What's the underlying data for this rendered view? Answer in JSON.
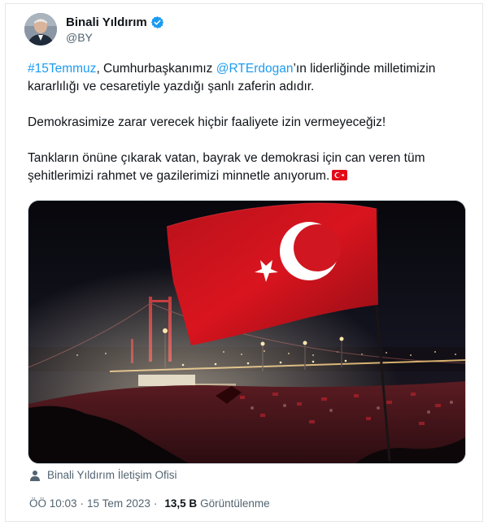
{
  "author": {
    "display_name": "Binali Yıldırım",
    "handle": "@BY",
    "verified": true
  },
  "tweet": {
    "hashtag": "#15Temmuz",
    "line1_after_hashtag": ", Cumhurbaşkanımız ",
    "mention": "@RTErdogan",
    "line1_rest": "’ın liderliğinde milletimizin kararlılığı ve cesaretiyle yazdığı şanlı zaferin adıdır.",
    "paragraph2": "Demokrasimize zarar verecek hiçbir faaliyete izin vermeyeceğiz!",
    "paragraph3": "Tankların önüne çıkarak vatan, bayrak ve demokrasi için can veren tüm şehitlerimizi rahmet ve gazilerimizi minnetle anıyorum.",
    "emoji": "turkey-flag-emoji"
  },
  "media": {
    "credit": "Binali Yıldırım İletişim Ofisi"
  },
  "meta": {
    "time": "ÖÖ 10:03",
    "separator": "·",
    "date": "15 Tem 2023",
    "separator2": "·",
    "views_count": "13,5 B",
    "views_label": "Görüntülenme"
  },
  "colors": {
    "link": "#1d9bf0",
    "verified": "#1d9bf0",
    "secondary_text": "#536471",
    "flag_red": "#e30a17"
  }
}
